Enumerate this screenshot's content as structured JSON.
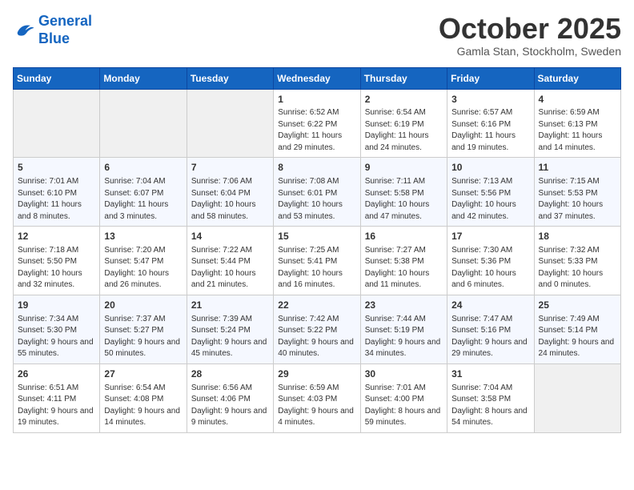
{
  "header": {
    "logo_line1": "General",
    "logo_line2": "Blue",
    "month": "October 2025",
    "location": "Gamla Stan, Stockholm, Sweden"
  },
  "weekdays": [
    "Sunday",
    "Monday",
    "Tuesday",
    "Wednesday",
    "Thursday",
    "Friday",
    "Saturday"
  ],
  "weeks": [
    [
      {
        "day": "",
        "empty": true
      },
      {
        "day": "",
        "empty": true
      },
      {
        "day": "",
        "empty": true
      },
      {
        "day": "1",
        "sunrise": "6:52 AM",
        "sunset": "6:22 PM",
        "daylight": "11 hours and 29 minutes."
      },
      {
        "day": "2",
        "sunrise": "6:54 AM",
        "sunset": "6:19 PM",
        "daylight": "11 hours and 24 minutes."
      },
      {
        "day": "3",
        "sunrise": "6:57 AM",
        "sunset": "6:16 PM",
        "daylight": "11 hours and 19 minutes."
      },
      {
        "day": "4",
        "sunrise": "6:59 AM",
        "sunset": "6:13 PM",
        "daylight": "11 hours and 14 minutes."
      }
    ],
    [
      {
        "day": "5",
        "sunrise": "7:01 AM",
        "sunset": "6:10 PM",
        "daylight": "11 hours and 8 minutes."
      },
      {
        "day": "6",
        "sunrise": "7:04 AM",
        "sunset": "6:07 PM",
        "daylight": "11 hours and 3 minutes."
      },
      {
        "day": "7",
        "sunrise": "7:06 AM",
        "sunset": "6:04 PM",
        "daylight": "10 hours and 58 minutes."
      },
      {
        "day": "8",
        "sunrise": "7:08 AM",
        "sunset": "6:01 PM",
        "daylight": "10 hours and 53 minutes."
      },
      {
        "day": "9",
        "sunrise": "7:11 AM",
        "sunset": "5:58 PM",
        "daylight": "10 hours and 47 minutes."
      },
      {
        "day": "10",
        "sunrise": "7:13 AM",
        "sunset": "5:56 PM",
        "daylight": "10 hours and 42 minutes."
      },
      {
        "day": "11",
        "sunrise": "7:15 AM",
        "sunset": "5:53 PM",
        "daylight": "10 hours and 37 minutes."
      }
    ],
    [
      {
        "day": "12",
        "sunrise": "7:18 AM",
        "sunset": "5:50 PM",
        "daylight": "10 hours and 32 minutes."
      },
      {
        "day": "13",
        "sunrise": "7:20 AM",
        "sunset": "5:47 PM",
        "daylight": "10 hours and 26 minutes."
      },
      {
        "day": "14",
        "sunrise": "7:22 AM",
        "sunset": "5:44 PM",
        "daylight": "10 hours and 21 minutes."
      },
      {
        "day": "15",
        "sunrise": "7:25 AM",
        "sunset": "5:41 PM",
        "daylight": "10 hours and 16 minutes."
      },
      {
        "day": "16",
        "sunrise": "7:27 AM",
        "sunset": "5:38 PM",
        "daylight": "10 hours and 11 minutes."
      },
      {
        "day": "17",
        "sunrise": "7:30 AM",
        "sunset": "5:36 PM",
        "daylight": "10 hours and 6 minutes."
      },
      {
        "day": "18",
        "sunrise": "7:32 AM",
        "sunset": "5:33 PM",
        "daylight": "10 hours and 0 minutes."
      }
    ],
    [
      {
        "day": "19",
        "sunrise": "7:34 AM",
        "sunset": "5:30 PM",
        "daylight": "9 hours and 55 minutes."
      },
      {
        "day": "20",
        "sunrise": "7:37 AM",
        "sunset": "5:27 PM",
        "daylight": "9 hours and 50 minutes."
      },
      {
        "day": "21",
        "sunrise": "7:39 AM",
        "sunset": "5:24 PM",
        "daylight": "9 hours and 45 minutes."
      },
      {
        "day": "22",
        "sunrise": "7:42 AM",
        "sunset": "5:22 PM",
        "daylight": "9 hours and 40 minutes."
      },
      {
        "day": "23",
        "sunrise": "7:44 AM",
        "sunset": "5:19 PM",
        "daylight": "9 hours and 34 minutes."
      },
      {
        "day": "24",
        "sunrise": "7:47 AM",
        "sunset": "5:16 PM",
        "daylight": "9 hours and 29 minutes."
      },
      {
        "day": "25",
        "sunrise": "7:49 AM",
        "sunset": "5:14 PM",
        "daylight": "9 hours and 24 minutes."
      }
    ],
    [
      {
        "day": "26",
        "sunrise": "6:51 AM",
        "sunset": "4:11 PM",
        "daylight": "9 hours and 19 minutes."
      },
      {
        "day": "27",
        "sunrise": "6:54 AM",
        "sunset": "4:08 PM",
        "daylight": "9 hours and 14 minutes."
      },
      {
        "day": "28",
        "sunrise": "6:56 AM",
        "sunset": "4:06 PM",
        "daylight": "9 hours and 9 minutes."
      },
      {
        "day": "29",
        "sunrise": "6:59 AM",
        "sunset": "4:03 PM",
        "daylight": "9 hours and 4 minutes."
      },
      {
        "day": "30",
        "sunrise": "7:01 AM",
        "sunset": "4:00 PM",
        "daylight": "8 hours and 59 minutes."
      },
      {
        "day": "31",
        "sunrise": "7:04 AM",
        "sunset": "3:58 PM",
        "daylight": "8 hours and 54 minutes."
      },
      {
        "day": "",
        "empty": true
      }
    ]
  ],
  "labels": {
    "sunrise": "Sunrise:",
    "sunset": "Sunset:",
    "daylight": "Daylight:"
  }
}
